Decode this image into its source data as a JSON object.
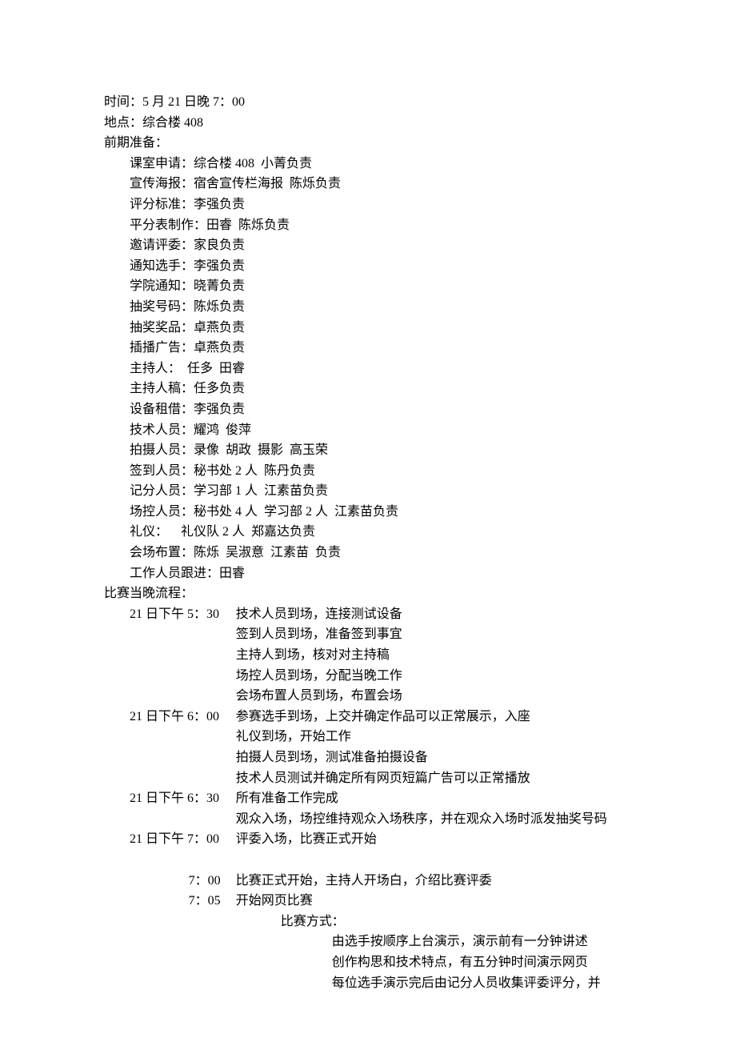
{
  "header": {
    "time": "时间：5 月 21 日晚 7：00",
    "location": "地点：综合楼 408",
    "prep_title": "前期准备："
  },
  "prep": [
    "课室申请：综合楼 408  小菁负责",
    "宣传海报：宿舍宣传栏海报  陈烁负责",
    "评分标准：李强负责",
    "平分表制作：田睿  陈烁负责",
    "邀请评委：家良负责",
    "通知选手：李强负责",
    "学院通知：晓菁负责",
    "抽奖号码：陈烁负责",
    "抽奖奖品：卓燕负责",
    "插播广告：卓燕负责",
    "主持人：  任多  田睿",
    "主持人稿：任多负责",
    "设备租借：李强负责",
    "技术人员：耀鸿  俊萍",
    "拍摄人员：录像  胡政  摄影  高玉荣",
    "签到人员：秘书处 2 人  陈丹负责",
    "记分人员：学习部 1 人  江素苗负责",
    "场控人员：秘书处 4 人  学习部 2 人  江素苗负责",
    "礼仪：    礼仪队 2 人  郑嘉达负责",
    "会场布置：陈烁  吴淑意  江素苗  负责",
    "工作人员跟进：田睿"
  ],
  "flow_title": "比赛当晚流程：",
  "schedule": [
    {
      "time": "21 日下午 5：30",
      "align": "left",
      "desc": "技术人员到场，连接测试设备"
    },
    {
      "time": "",
      "align": "left",
      "desc": "签到人员到场，准备签到事宜"
    },
    {
      "time": "",
      "align": "left",
      "desc": "主持人到场，核对对主持稿"
    },
    {
      "time": "",
      "align": "left",
      "desc": "场控人员到场，分配当晚工作"
    },
    {
      "time": "",
      "align": "left",
      "desc": "会场布置人员到场，布置会场"
    },
    {
      "time": "21 日下午 6：00",
      "align": "left",
      "desc": "参赛选手到场，上交并确定作品可以正常展示，入座"
    },
    {
      "time": "",
      "align": "left",
      "desc": "礼仪到场，开始工作"
    },
    {
      "time": "",
      "align": "left",
      "desc": "拍摄人员到场，测试准备拍摄设备"
    },
    {
      "time": "",
      "align": "left",
      "desc": "技术人员测试并确定所有网页短篇广告可以正常播放"
    },
    {
      "time": "21 日下午 6：30",
      "align": "left",
      "desc": "所有准备工作完成"
    },
    {
      "time": "",
      "align": "left",
      "desc": "观众入场，场控维持观众入场秩序，并在观众入场时派发抽奖号码"
    },
    {
      "time": "21 日下午 7：00",
      "align": "left",
      "desc": "评委入场，比赛正式开始"
    }
  ],
  "schedule2": [
    {
      "time": "7：00",
      "align": "right",
      "desc": "比赛正式开始，主持人开场白，介绍比赛评委"
    },
    {
      "time": "7：05",
      "align": "right",
      "desc": "开始网页比赛"
    }
  ],
  "method": {
    "label": "比赛方式：",
    "lines": [
      "由选手按顺序上台演示，演示前有一分钟讲述",
      "创作构思和技术特点，有五分钟时间演示网页",
      "每位选手演示完后由记分人员收集评委评分，并"
    ]
  }
}
